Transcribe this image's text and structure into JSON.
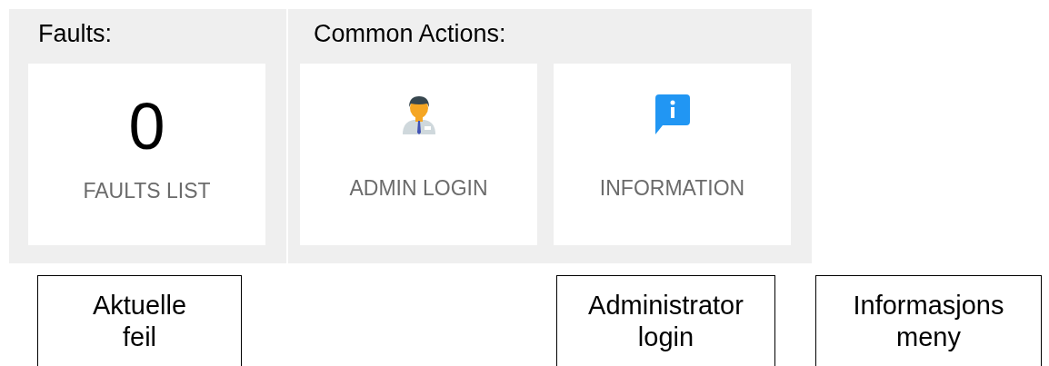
{
  "sections": [
    {
      "title": "Faults:",
      "cards": [
        {
          "kind": "count",
          "value": "0",
          "label": "FAULTS LIST"
        }
      ]
    },
    {
      "title": "Common Actions:",
      "cards": [
        {
          "kind": "person",
          "label": "ADMIN LOGIN"
        },
        {
          "kind": "info",
          "label": "INFORMATION"
        }
      ]
    }
  ],
  "callouts": [
    {
      "text": "Aktuelle feil"
    },
    {
      "text": "Administrator login"
    },
    {
      "text": "Informasjons meny"
    }
  ]
}
